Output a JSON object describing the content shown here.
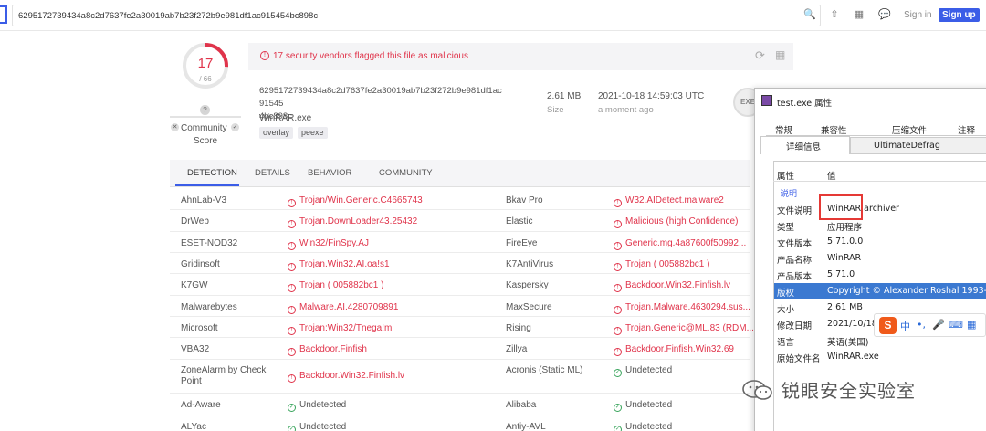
{
  "search": {
    "value": "6295172739434a8c2d7637fe2a30019ab7b23f272b9e981df1ac915454bc898c"
  },
  "header": {
    "signin": "Sign in",
    "signup": "Sign up"
  },
  "score": {
    "detected": "17",
    "total": "/ 66",
    "fraction": 0.2576,
    "community_q": "?",
    "community_label_1": "Community",
    "community_label_2": "Score"
  },
  "alert": {
    "text": "17 security vendors flagged this file as malicious"
  },
  "file": {
    "hash_line1": "6295172739434a8c2d7637fe2a30019ab7b23f272b9e981df1ac91545",
    "hash_line2": "4bc898c",
    "name": "WinRAR.exe",
    "tags": [
      "overlay",
      "peexe"
    ],
    "size_value": "2.61 MB",
    "size_label": "Size",
    "date_value": "2021-10-18 14:59:03 UTC",
    "date_label": "a moment ago",
    "type_badge": "EXE"
  },
  "tabs": [
    "DETECTION",
    "DETAILS",
    "BEHAVIOR",
    "COMMUNITY"
  ],
  "detections": [
    {
      "v1": "AhnLab-V3",
      "r1": "Trojan/Win.Generic.C4665743",
      "v2": "Bkav Pro",
      "r2": "W32.AIDetect.malware2",
      "ok2": false
    },
    {
      "v1": "DrWeb",
      "r1": "Trojan.DownLoader43.25432",
      "v2": "Elastic",
      "r2": "Malicious (high Confidence)",
      "ok2": false
    },
    {
      "v1": "ESET-NOD32",
      "r1": "Win32/FinSpy.AJ",
      "v2": "FireEye",
      "r2": "Generic.mg.4a87600f50992...",
      "ok2": false
    },
    {
      "v1": "Gridinsoft",
      "r1": "Trojan.Win32.AI.oa!s1",
      "v2": "K7AntiVirus",
      "r2": "Trojan ( 005882bc1 )",
      "ok2": false
    },
    {
      "v1": "K7GW",
      "r1": "Trojan ( 005882bc1 )",
      "v2": "Kaspersky",
      "r2": "Backdoor.Win32.Finfish.lv",
      "ok2": false
    },
    {
      "v1": "Malwarebytes",
      "r1": "Malware.AI.4280709891",
      "v2": "MaxSecure",
      "r2": "Trojan.Malware.4630294.sus...",
      "ok2": false
    },
    {
      "v1": "Microsoft",
      "r1": "Trojan:Win32/Tnega!ml",
      "v2": "Rising",
      "r2": "Trojan.Generic@ML.83 (RDM...",
      "ok2": false
    },
    {
      "v1": "VBA32",
      "r1": "Backdoor.Finfish",
      "v2": "Zillya",
      "r2": "Backdoor.Finfish.Win32.69",
      "ok2": false
    },
    {
      "v1": "ZoneAlarm by Check Point",
      "r1": "Backdoor.Win32.Finfish.lv",
      "v2": "Acronis (Static ML)",
      "r2": "Undetected",
      "ok2": true
    },
    {
      "v1": "Ad-Aware",
      "r1": "Undetected",
      "ok1": true,
      "v2": "Alibaba",
      "r2": "Undetected",
      "ok2": true
    },
    {
      "v1": "ALYac",
      "r1": "Undetected",
      "ok1": true,
      "v2": "Antiy-AVL",
      "r2": "Undetected",
      "ok2": true
    }
  ],
  "dialog": {
    "title": "test.exe 属性",
    "tabs_row1": [
      "常规",
      "兼容性",
      "压缩文件",
      "注释"
    ],
    "tab_selected": "详细信息",
    "tab_other": "UltimateDefrag",
    "col_prop": "属性",
    "col_val": "值",
    "section": "说明",
    "rows": [
      {
        "k": "文件说明",
        "v": "WinRAR archiver"
      },
      {
        "k": "类型",
        "v": "应用程序"
      },
      {
        "k": "文件版本",
        "v": "5.71.0.0"
      },
      {
        "k": "产品名称",
        "v": "WinRAR"
      },
      {
        "k": "产品版本",
        "v": "5.71.0"
      },
      {
        "k": "版权",
        "v": "Copyright © Alexander Roshal 1993-"
      },
      {
        "k": "大小",
        "v": "2.61 MB"
      },
      {
        "k": "修改日期",
        "v": "2021/10/18"
      },
      {
        "k": "语言",
        "v": "英语(美国)"
      },
      {
        "k": "原始文件名",
        "v": "WinRAR.exe"
      }
    ]
  },
  "ime": {
    "logo": "S",
    "lang": "中"
  },
  "watermark": {
    "text": "锐眼安全实验室"
  },
  "colors": {
    "accent": "#3b5de7",
    "malicious": "#e0344b",
    "clean": "#3aa55d",
    "selection": "#3b79d1"
  }
}
